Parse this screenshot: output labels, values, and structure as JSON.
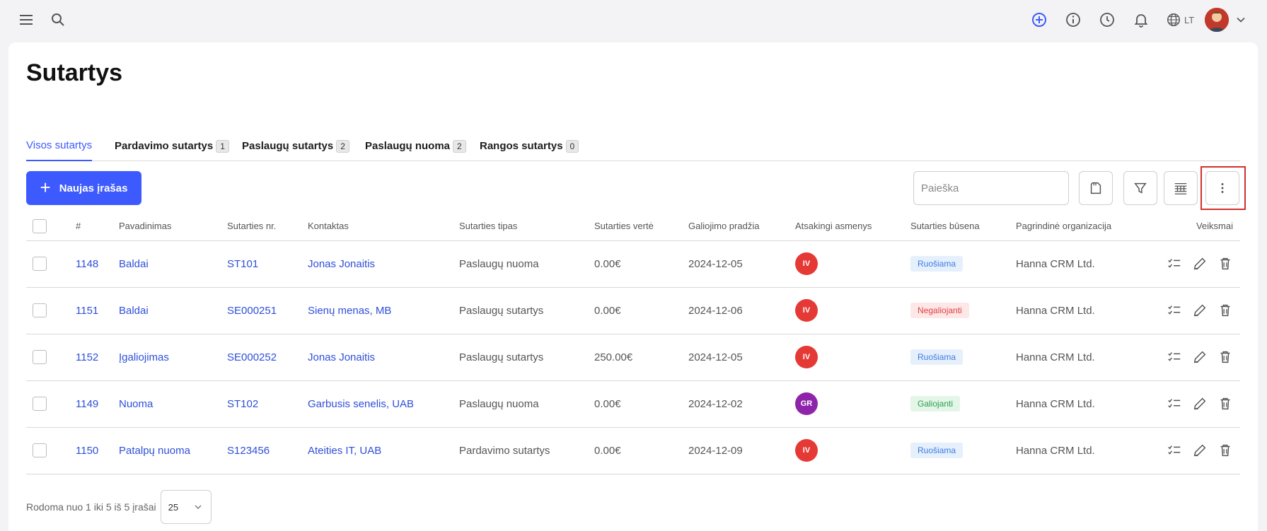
{
  "topbar": {
    "icons": [
      "menu-icon",
      "search-icon",
      "add-circle-icon",
      "info-icon",
      "clock-icon",
      "bell-icon",
      "globe-icon"
    ],
    "language": "LT",
    "accent": "#3d5afe"
  },
  "page": {
    "title": "Sutartys"
  },
  "tabs": [
    {
      "label": "Visos sutartys",
      "count": null,
      "active": true
    },
    {
      "label": "Pardavimo sutartys",
      "count": "1"
    },
    {
      "label": "Paslaugų sutartys",
      "count": "2"
    },
    {
      "label": "Paslaugų nuoma",
      "count": "2"
    },
    {
      "label": "Rangos sutartys",
      "count": "0"
    }
  ],
  "toolbar": {
    "new_label": "Naujas įrašas",
    "search_placeholder": "Paieška"
  },
  "table": {
    "columns": [
      "#",
      "Pavadinimas",
      "Sutarties nr.",
      "Kontaktas",
      "Sutarties tipas",
      "Sutarties vertė",
      "Galiojimo pradžia",
      "Atsakingi asmenys",
      "Sutarties būsena",
      "Pagrindinė organizacija",
      "Veiksmai"
    ],
    "rows": [
      {
        "id": "1148",
        "name": "Baldai",
        "number": "ST101",
        "contact": "Jonas Jonaitis",
        "type": "Paslaugų nuoma",
        "value": "0.00€",
        "start": "2024-12-05",
        "owner": "IV",
        "owner_color": "#e53935",
        "status": "Ruošiama",
        "status_kind": "ruosiama",
        "org": "Hanna CRM Ltd."
      },
      {
        "id": "1151",
        "name": "Baldai",
        "number": "SE000251",
        "contact": "Sienų menas, MB",
        "type": "Paslaugų sutartys",
        "value": "0.00€",
        "start": "2024-12-06",
        "owner": "IV",
        "owner_color": "#e53935",
        "status": "Negaliojanti",
        "status_kind": "negaliojanti",
        "org": "Hanna CRM Ltd."
      },
      {
        "id": "1152",
        "name": "Įgaliojimas",
        "number": "SE000252",
        "contact": "Jonas Jonaitis",
        "type": "Paslaugų sutartys",
        "value": "250.00€",
        "start": "2024-12-05",
        "owner": "IV",
        "owner_color": "#e53935",
        "status": "Ruošiama",
        "status_kind": "ruosiama",
        "org": "Hanna CRM Ltd."
      },
      {
        "id": "1149",
        "name": "Nuoma",
        "number": "ST102",
        "contact": "Garbusis senelis, UAB",
        "type": "Paslaugų nuoma",
        "value": "0.00€",
        "start": "2024-12-02",
        "owner": "GR",
        "owner_color": "#8e24aa",
        "status": "Galiojanti",
        "status_kind": "galiojanti",
        "org": "Hanna CRM Ltd."
      },
      {
        "id": "1150",
        "name": "Patalpų nuoma",
        "number": "S123456",
        "contact": "Ateities IT, UAB",
        "type": "Pardavimo sutartys",
        "value": "0.00€",
        "start": "2024-12-09",
        "owner": "IV",
        "owner_color": "#e53935",
        "status": "Ruošiama",
        "status_kind": "ruosiama",
        "org": "Hanna CRM Ltd."
      }
    ]
  },
  "footer": {
    "info": "Rodoma nuo 1 iki 5 iš 5 įrašai",
    "page_size": "25"
  }
}
